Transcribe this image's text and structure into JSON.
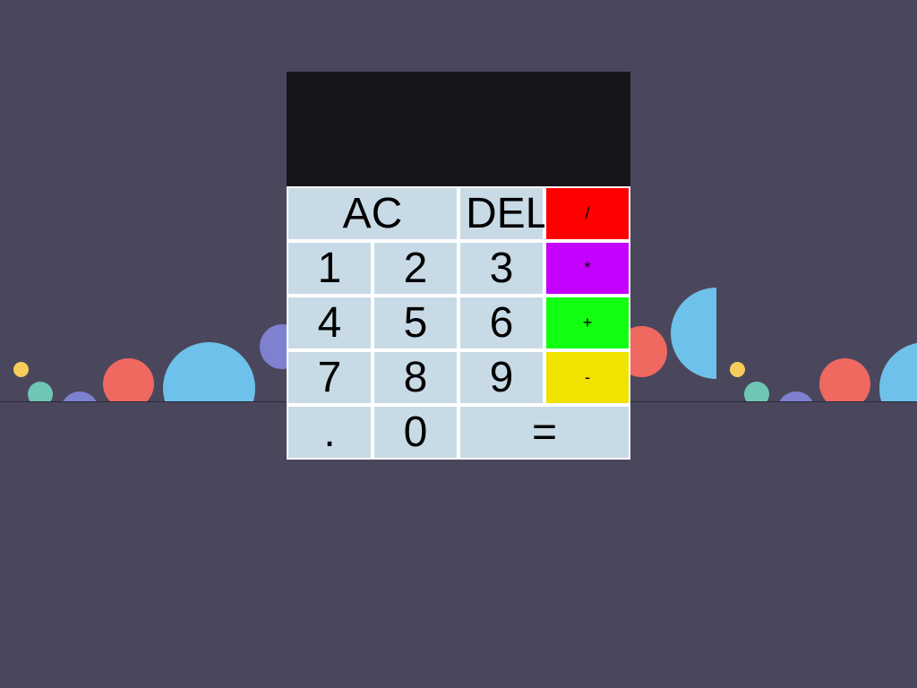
{
  "calculator": {
    "display": {
      "previous": "",
      "current": ""
    },
    "keys": {
      "ac": "AC",
      "del": "DEL",
      "divide": "/",
      "multiply": "*",
      "add": "+",
      "subtract": "-",
      "one": "1",
      "two": "2",
      "three": "3",
      "four": "4",
      "five": "5",
      "six": "6",
      "seven": "7",
      "eight": "8",
      "nine": "9",
      "zero": "0",
      "decimal": ".",
      "equals": "="
    },
    "colors": {
      "key_bg": "#c8dae6",
      "display_bg": "#16151a",
      "divide": "#ff0000",
      "multiply": "#c400ff",
      "add": "#11ff11",
      "subtract": "#f2e200"
    }
  },
  "background": {
    "color": "#4a475d",
    "circle_colors": [
      "#f6cd5a",
      "#70c6b4",
      "#7e80d0",
      "#ef6960",
      "#6ec1ea"
    ]
  }
}
